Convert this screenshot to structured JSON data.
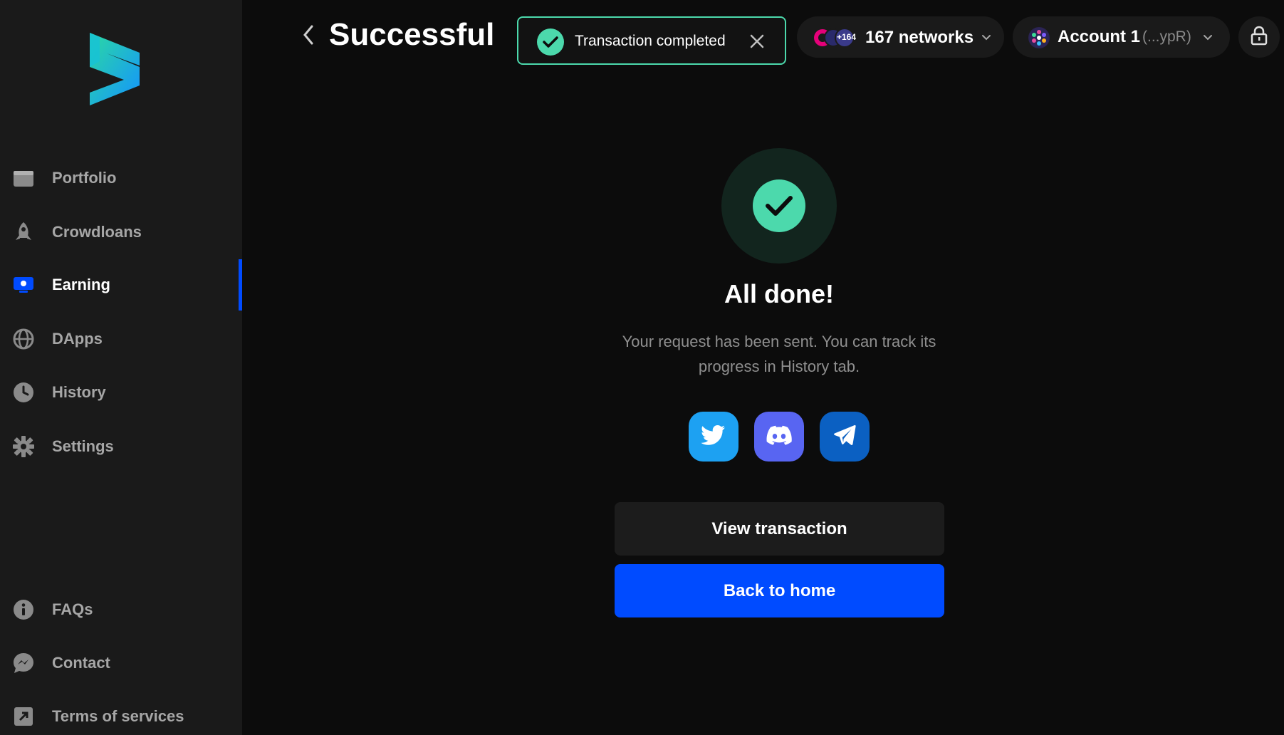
{
  "colors": {
    "accent": "#004bff",
    "success": "#4cd9ac",
    "sidebar_bg": "#1a1a1a",
    "page_bg": "#0c0c0c"
  },
  "sidebar": {
    "logo": "subwallet-logo",
    "items": [
      {
        "label": "Portfolio",
        "icon": "wallet-icon"
      },
      {
        "label": "Crowdloans",
        "icon": "rocket-icon"
      },
      {
        "label": "Earning",
        "icon": "piggy-bank-icon",
        "active": true
      },
      {
        "label": "DApps",
        "icon": "globe-icon"
      },
      {
        "label": "History",
        "icon": "clock-icon"
      },
      {
        "label": "Settings",
        "icon": "gear-icon"
      }
    ],
    "bottom_items": [
      {
        "label": "FAQs",
        "icon": "info-icon"
      },
      {
        "label": "Contact",
        "icon": "chat-icon"
      },
      {
        "label": "Terms of services",
        "icon": "external-link-icon"
      }
    ]
  },
  "header": {
    "title": "Successful",
    "toast": {
      "message": "Transaction completed"
    },
    "networks": {
      "extra_count": "+164",
      "label": "167 networks"
    },
    "account": {
      "name": "Account 1",
      "address": "(...ypR)"
    }
  },
  "main": {
    "heading": "All done!",
    "description": "Your request has been sent. You can track its progress in History tab.",
    "socials": [
      "twitter-icon",
      "discord-icon",
      "telegram-icon"
    ],
    "view_transaction_label": "View transaction",
    "back_home_label": "Back to home"
  }
}
